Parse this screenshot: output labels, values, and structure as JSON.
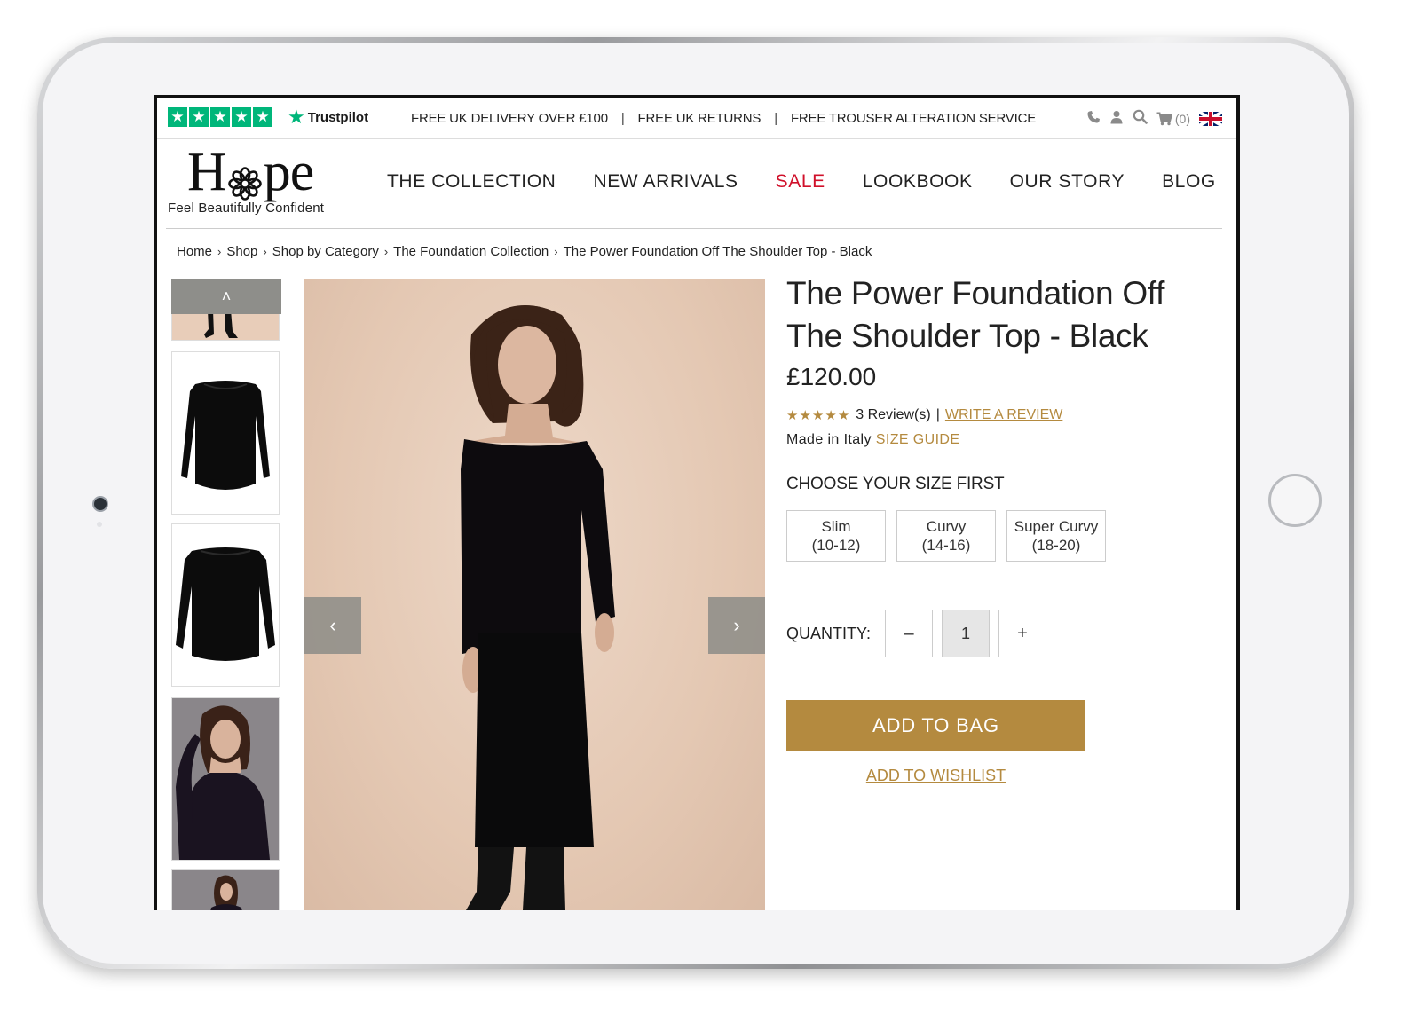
{
  "topbar": {
    "trustpilot_brand": "Trustpilot",
    "trustpilot_star_glyph": "★",
    "promos": [
      "FREE UK DELIVERY OVER £100",
      "FREE UK RETURNS",
      "FREE TROUSER ALTERATION SERVICE"
    ],
    "promo_separator": "|",
    "cart_count": "(0)",
    "icons": [
      "phone-icon",
      "account-icon",
      "search-icon",
      "cart-icon",
      "uk-flag-icon"
    ]
  },
  "header": {
    "logo_left": "H",
    "logo_right": "pe",
    "tagline": "Feel Beautifully Confident",
    "nav": [
      "THE COLLECTION",
      "NEW ARRIVALS",
      "SALE",
      "LOOKBOOK",
      "OUR STORY",
      "BLOG"
    ]
  },
  "breadcrumbs": [
    "Home",
    "Shop",
    "Shop by Category",
    "The Foundation Collection",
    "The Power Foundation Off The Shoulder Top - Black"
  ],
  "breadcrumb_separator": "›",
  "gallery": {
    "up_arrow": "˄",
    "prev_arrow": "‹",
    "next_arrow": "›"
  },
  "product": {
    "title": "The Power Foundation Off The Shoulder Top - Black",
    "price": "£120.00",
    "rating_stars": 5,
    "rating_stars_text": "★★★★★",
    "reviews": "3 Review(s)",
    "reviews_separator": "|",
    "write_review": "WRITE A REVIEW",
    "made_in": "Made in Italy",
    "size_guide": "SIZE GUIDE",
    "choose_size": "CHOOSE YOUR SIZE FIRST",
    "sizes": [
      {
        "name": "Slim",
        "range": "(10-12)"
      },
      {
        "name": "Curvy",
        "range": "(14-16)"
      },
      {
        "name": "Super Curvy",
        "range": "(18-20)"
      }
    ],
    "quantity_label": "QUANTITY:",
    "qty_minus": "–",
    "quantity": "1",
    "qty_plus": "+",
    "add_to_bag": "ADD TO BAG",
    "add_to_wishlist": "ADD TO WISHLIST"
  },
  "colors": {
    "gold": "#b48a3f",
    "sale_red": "#d0102a",
    "trustpilot_green": "#00b67a"
  }
}
